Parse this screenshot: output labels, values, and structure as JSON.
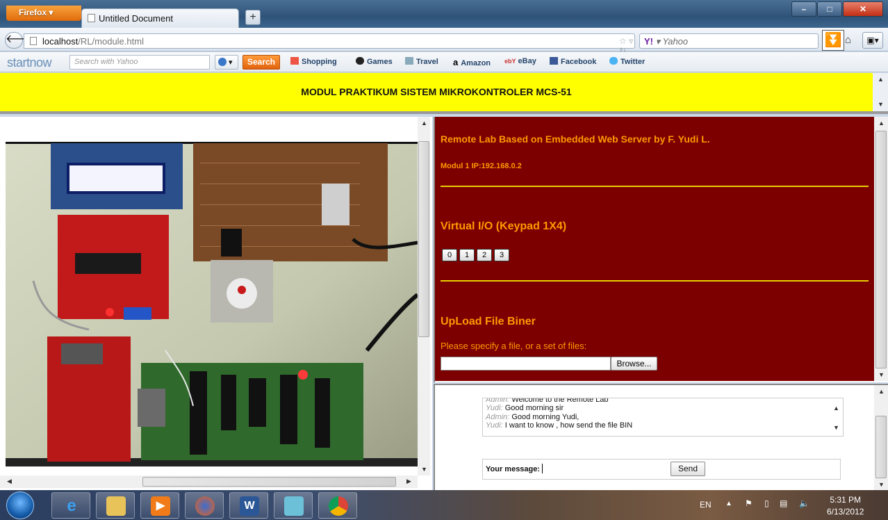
{
  "browser": {
    "menu_button": "Firefox",
    "tab_title": "Untitled Document",
    "new_tab": "+",
    "url_host": "localhost",
    "url_path": "/RL/module.html",
    "search_engine": "Yahoo",
    "yahoo_logo": "Y!"
  },
  "toolbar": {
    "brand": "startnow",
    "search_placeholder": "Search with Yahoo",
    "search_button": "Search",
    "links": [
      "Shopping",
      "Games",
      "Travel",
      "Amazon",
      "eBay",
      "Facebook",
      "Twitter"
    ]
  },
  "header": {
    "title": "MODUL PRAKTIKUM SISTEM MIKROKONTROLER MCS-51"
  },
  "lab_panel": {
    "title": "Remote Lab Based on Embedded Web Server by F. Yudi L.",
    "module_ip": "Modul 1 IP:192.168.0.2",
    "virtual_io_title": "Virtual I/O (Keypad 1X4)",
    "keys": [
      "0",
      "1",
      "2",
      "3"
    ],
    "upload_title": "UpLoad File Biner",
    "upload_hint": "Please specify a file, or a set of files:",
    "browse_button": "Browse..."
  },
  "chat": {
    "messages": [
      {
        "who": "Admin:",
        "text": "Welcome to the Remote Lab"
      },
      {
        "who": "Yudi:",
        "text": "Good morning sir"
      },
      {
        "who": "Admin:",
        "text": "Good morning Yudi,"
      },
      {
        "who": "Yudi:",
        "text": "I want to know , how send the file BIN"
      }
    ],
    "message_label": "Your message:",
    "send_button": "Send"
  },
  "taskbar": {
    "language": "EN",
    "time": "5:31 PM",
    "date": "6/13/2012"
  },
  "colors": {
    "header_yellow": "#ffff00",
    "panel_maroon": "#7d0000",
    "panel_text": "#ff9900"
  }
}
